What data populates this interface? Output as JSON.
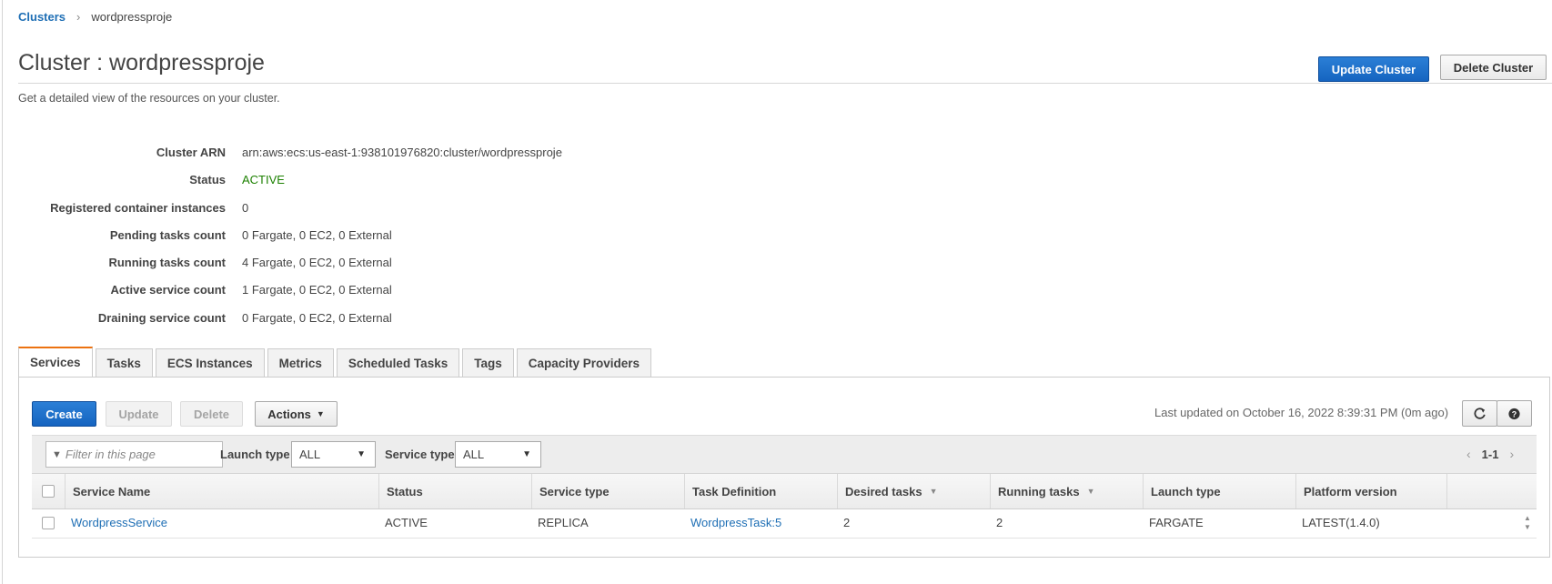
{
  "breadcrumb": {
    "root": "Clusters",
    "current": "wordpressproje"
  },
  "header": {
    "title": "Cluster : wordpressproje",
    "subtitle": "Get a detailed view of the resources on your cluster.",
    "update_button": "Update Cluster",
    "delete_button": "Delete Cluster"
  },
  "details": [
    {
      "label": "Cluster ARN",
      "value": "arn:aws:ecs:us-east-1:938101976820:cluster/wordpressproje"
    },
    {
      "label": "Status",
      "value": "ACTIVE"
    },
    {
      "label": "Registered container instances",
      "value": "0"
    },
    {
      "label": "Pending tasks count",
      "value": "0 Fargate, 0 EC2, 0 External"
    },
    {
      "label": "Running tasks count",
      "value": "4 Fargate, 0 EC2, 0 External"
    },
    {
      "label": "Active service count",
      "value": "1 Fargate, 0 EC2, 0 External"
    },
    {
      "label": "Draining service count",
      "value": "0 Fargate, 0 EC2, 0 External"
    }
  ],
  "tabs": [
    "Services",
    "Tasks",
    "ECS Instances",
    "Metrics",
    "Scheduled Tasks",
    "Tags",
    "Capacity Providers"
  ],
  "active_tab": "Services",
  "toolbar": {
    "create": "Create",
    "update": "Update",
    "delete": "Delete",
    "actions": "Actions",
    "last_updated": "Last updated on October 16, 2022 8:39:31 PM (0m ago)",
    "refresh_icon": "refresh-icon",
    "help_icon": "help-icon"
  },
  "filters": {
    "search_placeholder": "Filter in this page",
    "launch_type_label": "Launch type",
    "launch_type_value": "ALL",
    "service_type_label": "Service type",
    "service_type_value": "ALL",
    "pager": "1-1"
  },
  "table": {
    "columns": [
      "Service Name",
      "Status",
      "Service type",
      "Task Definition",
      "Desired tasks",
      "Running tasks",
      "Launch type",
      "Platform version"
    ],
    "rows": [
      {
        "service_name": "WordpressService",
        "status": "ACTIVE",
        "service_type": "REPLICA",
        "task_definition": "WordpressTask:5",
        "desired_tasks": "2",
        "running_tasks": "2",
        "launch_type": "FARGATE",
        "platform_version": "LATEST(1.4.0)"
      }
    ]
  },
  "colors": {
    "primary": "#1564c0",
    "link": "#1f6fb5",
    "active": "#1d8102",
    "tab_accent": "#ec7211"
  }
}
